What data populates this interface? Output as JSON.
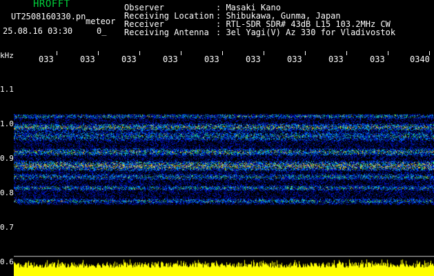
{
  "app_title": "HROFFT",
  "file_name": "UT2508160330.pn",
  "mode_label": "meteor",
  "timestamp": "25.08.16 03:30",
  "count_text": "0_",
  "header": {
    "labels": [
      "Observer",
      "Receiving Location",
      "Receiver",
      "Receiving Antenna"
    ],
    "values": [
      ": Masaki Kano",
      ": Shibukawa, Gunma, Japan",
      ": RTL-SDR SDR# 43dB L15 103.2MHz CW",
      ": 3el Yagi(V) Az 330 for Vladivostok"
    ]
  },
  "y_axis": {
    "unit": "kHz",
    "ticks": [
      "1.1",
      "1.0",
      "0.9",
      "0.8",
      "0.7",
      "0.6"
    ]
  },
  "x_axis": {
    "ticks": [
      "033",
      "033",
      "033",
      "033",
      "033",
      "033",
      "033",
      "033",
      "033",
      "0340"
    ]
  },
  "colors": {
    "title": "#00d23c",
    "background": "#000000",
    "text": "#ffffff",
    "noise_bar": "#ffff00",
    "signal_low": "#1e3cff",
    "signal_mid": "#00e070",
    "signal_high": "#ff3030"
  }
}
